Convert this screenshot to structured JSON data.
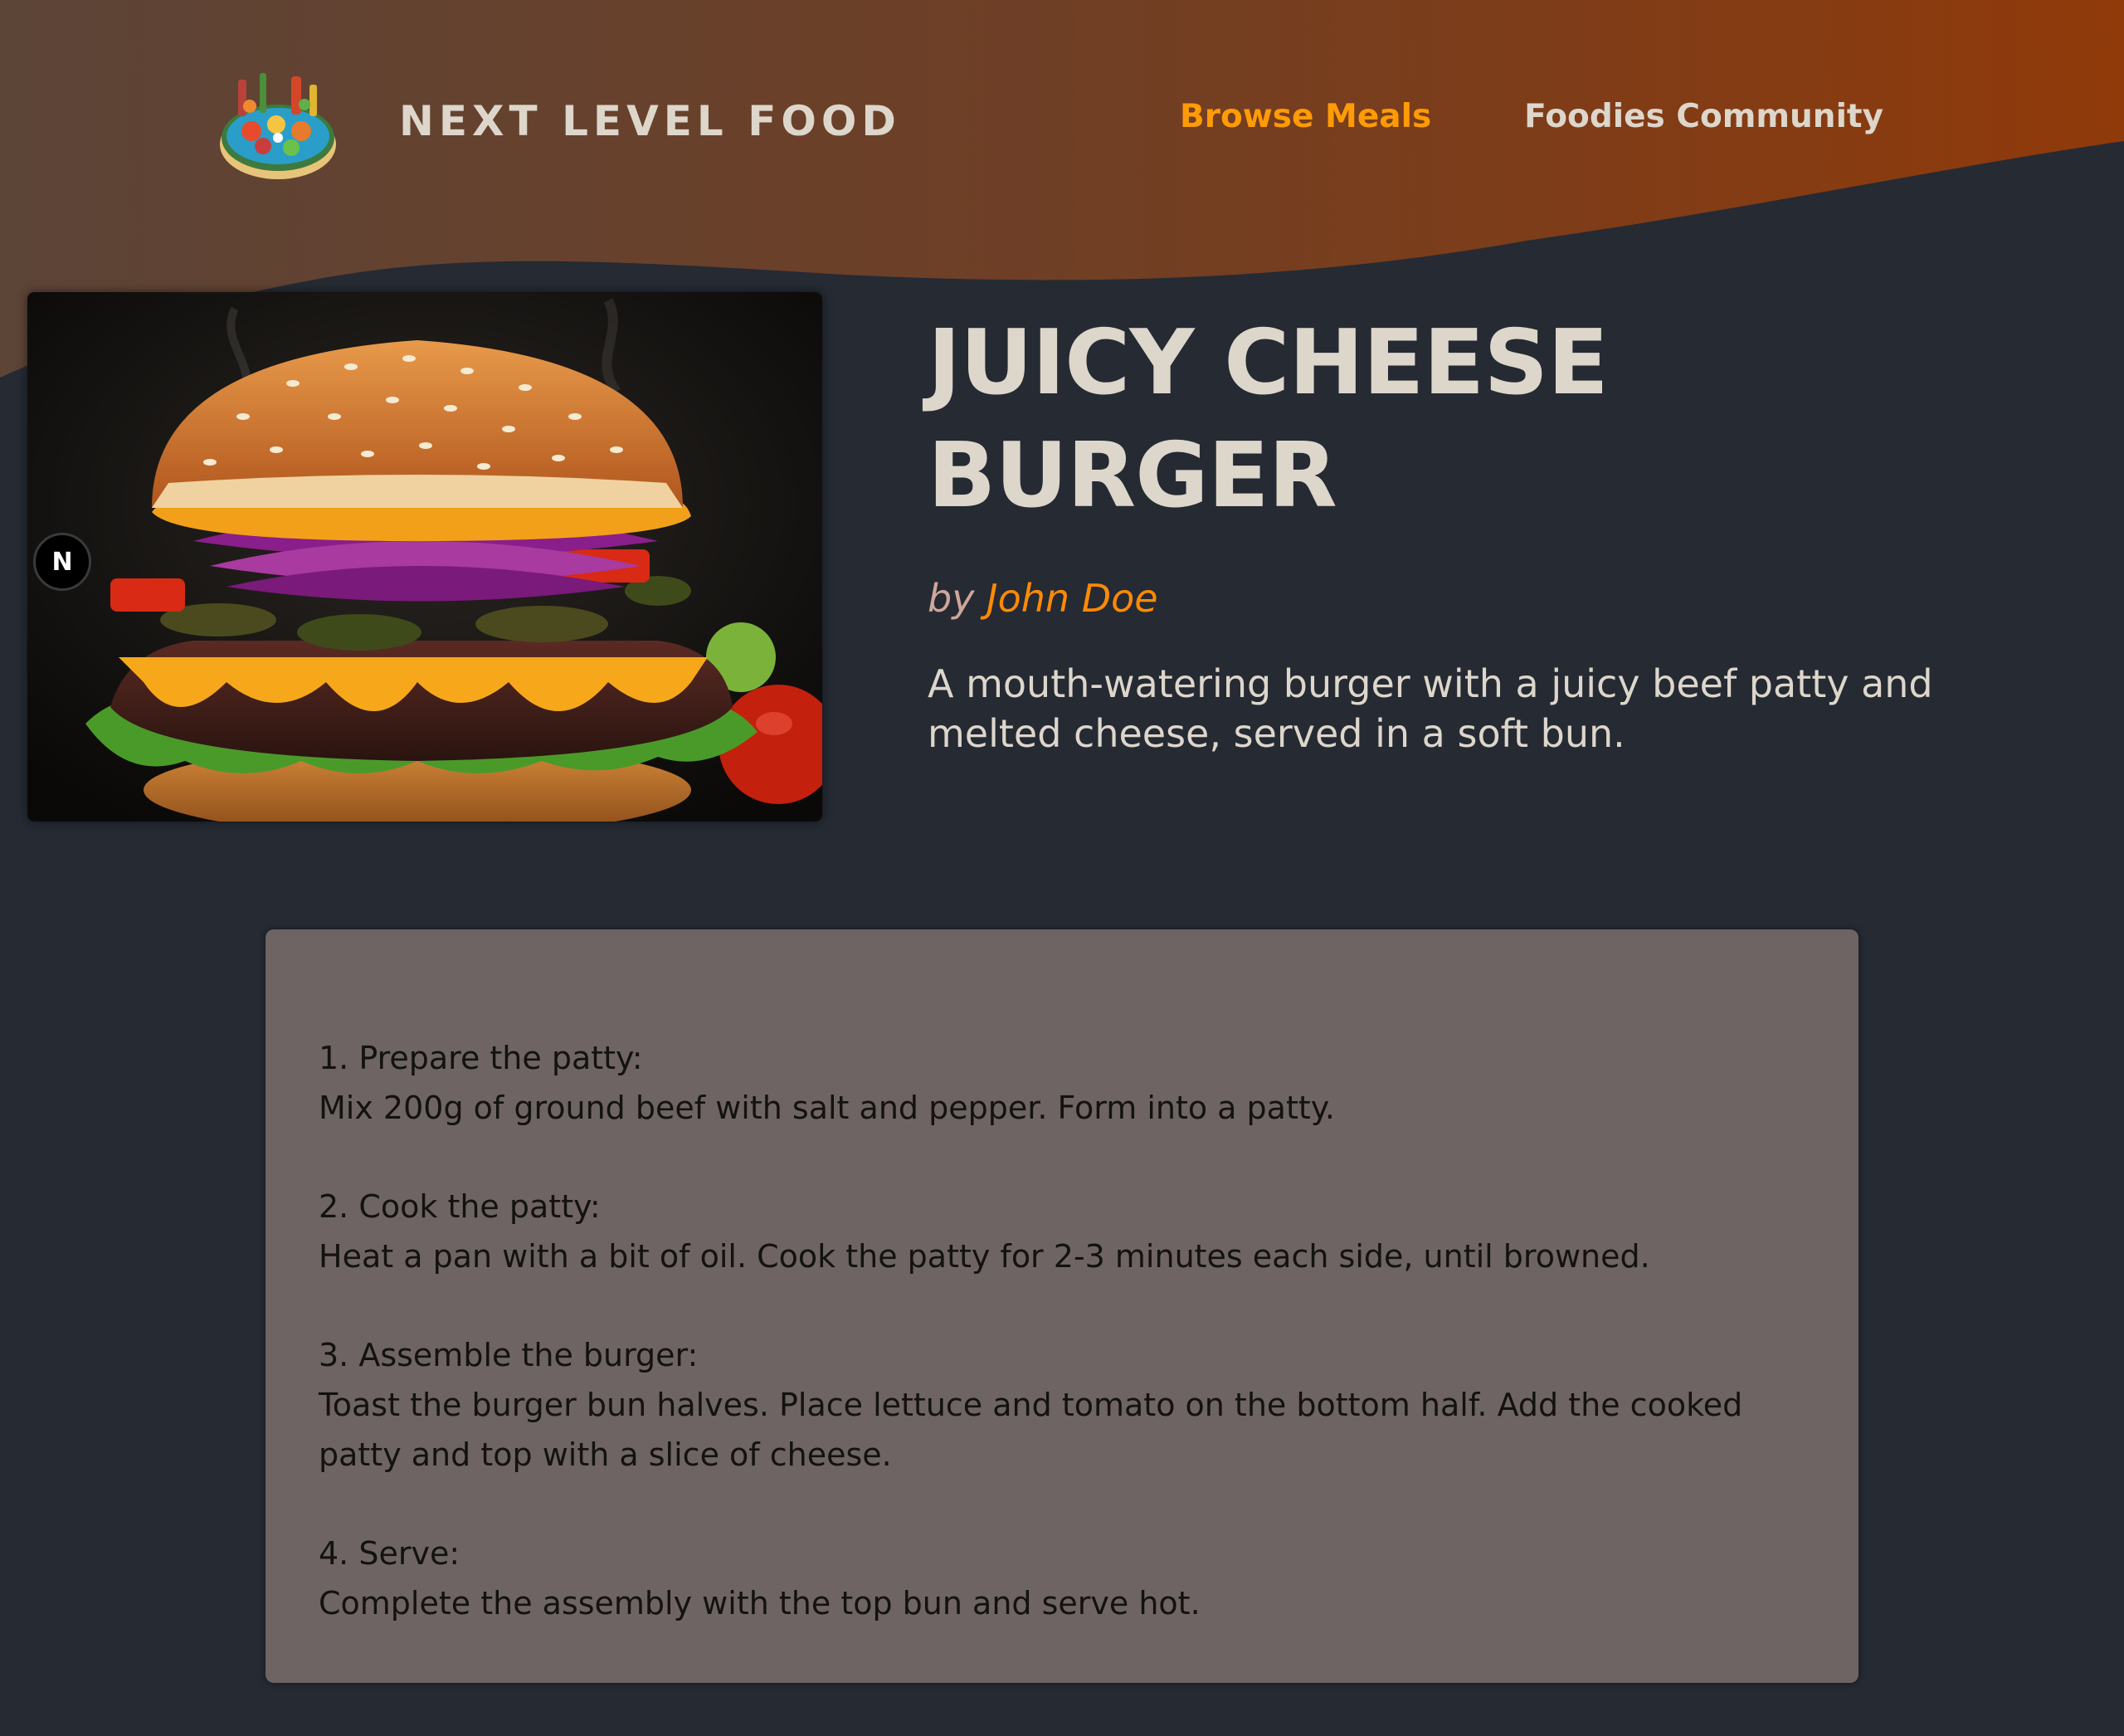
{
  "header": {
    "logo_text": "NEXT LEVEL FOOD",
    "logo_icon": "food-platter-logo",
    "nav": [
      {
        "label": "Browse Meals",
        "active": true
      },
      {
        "label": "Foodies Community",
        "active": false
      }
    ]
  },
  "meal": {
    "title": "JUICY CHEESE BURGER",
    "creator_prefix": "by",
    "creator_name": "John Doe",
    "summary": "A mouth-watering burger with a juicy beef patty and melted cheese, served in a soft bun.",
    "image_alt": "Juicy Cheese Burger"
  },
  "dev_badge": "N",
  "instructions": [
    {
      "title": "1. Prepare the patty:",
      "text": "Mix 200g of ground beef with salt and pepper. Form into a patty."
    },
    {
      "title": "2. Cook the patty:",
      "text": "Heat a pan with a bit of oil. Cook the patty for 2-3 minutes each side, until browned."
    },
    {
      "title": "3. Assemble the burger:",
      "text": "Toast the burger bun halves. Place lettuce and tomato on the bottom half. Add the cooked patty and top with a slice of cheese."
    },
    {
      "title": "4. Serve:",
      "text": "Complete the assembly with the top bun and serve hot."
    }
  ],
  "colors": {
    "background": "#252a33",
    "header_gradient_start": "#5a4438",
    "header_gradient_end": "#8f3a09",
    "accent_orange": "#ff8a05",
    "nav_active": "#ff9b05",
    "text_light": "#ddd6cb",
    "instructions_bg": "#6e6464"
  }
}
